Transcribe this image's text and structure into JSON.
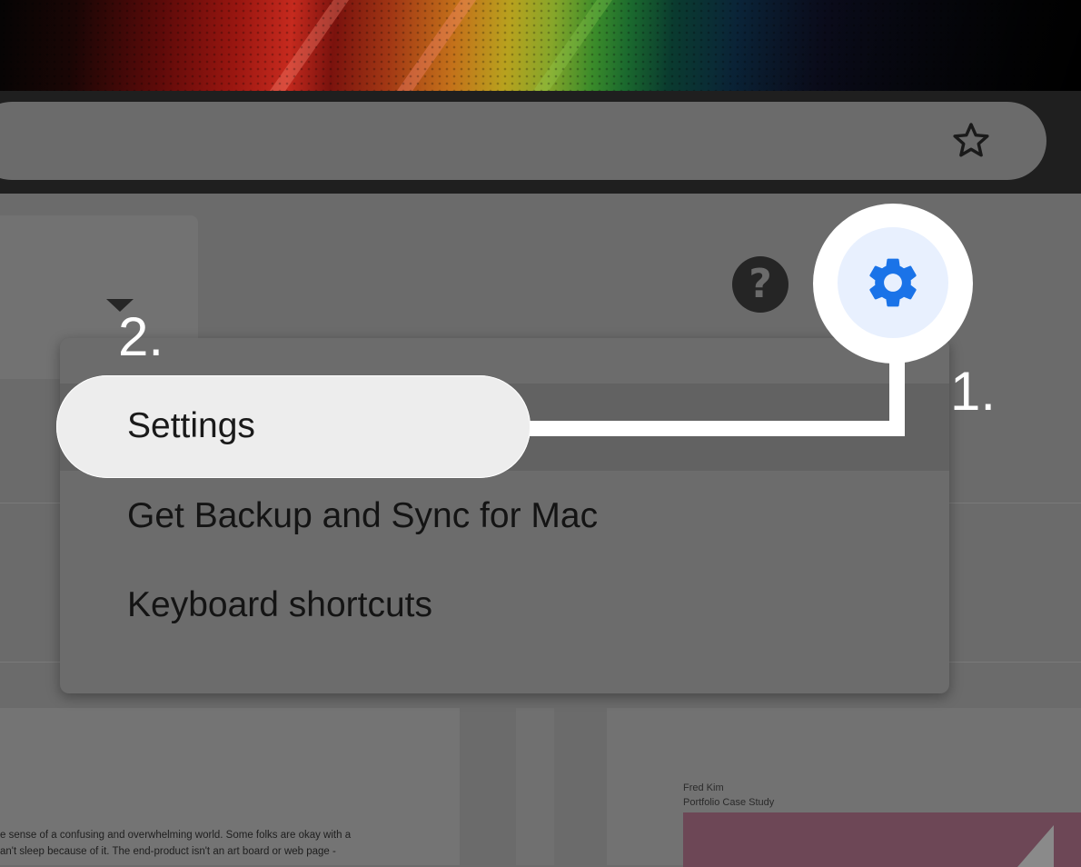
{
  "menu": {
    "items": [
      {
        "label": "Settings"
      },
      {
        "label": "Get Backup and Sync for Mac"
      },
      {
        "label": "Keyboard shortcuts"
      }
    ]
  },
  "callouts": {
    "step1": "1.",
    "step2": "2."
  },
  "help_button": {
    "glyph": "?"
  },
  "documents": {
    "left_lines": [
      "e sense of a confusing and overwhelming world. Some folks are okay with a",
      "an't sleep because of it. The end-product isn't an art board or web page -"
    ],
    "right_author": "Fred Kim",
    "right_subtitle": "Portfolio Case Study"
  },
  "icons": {
    "bookmark": "star-outline-icon",
    "settings": "gear-icon",
    "help": "help-circle-icon",
    "dropdown": "caret-down-icon"
  },
  "colors": {
    "settings_accent": "#1a73e8",
    "settings_bg": "#e8f0fe",
    "highlight_pill": "#ededed",
    "overlay": "#6b6b6b"
  }
}
